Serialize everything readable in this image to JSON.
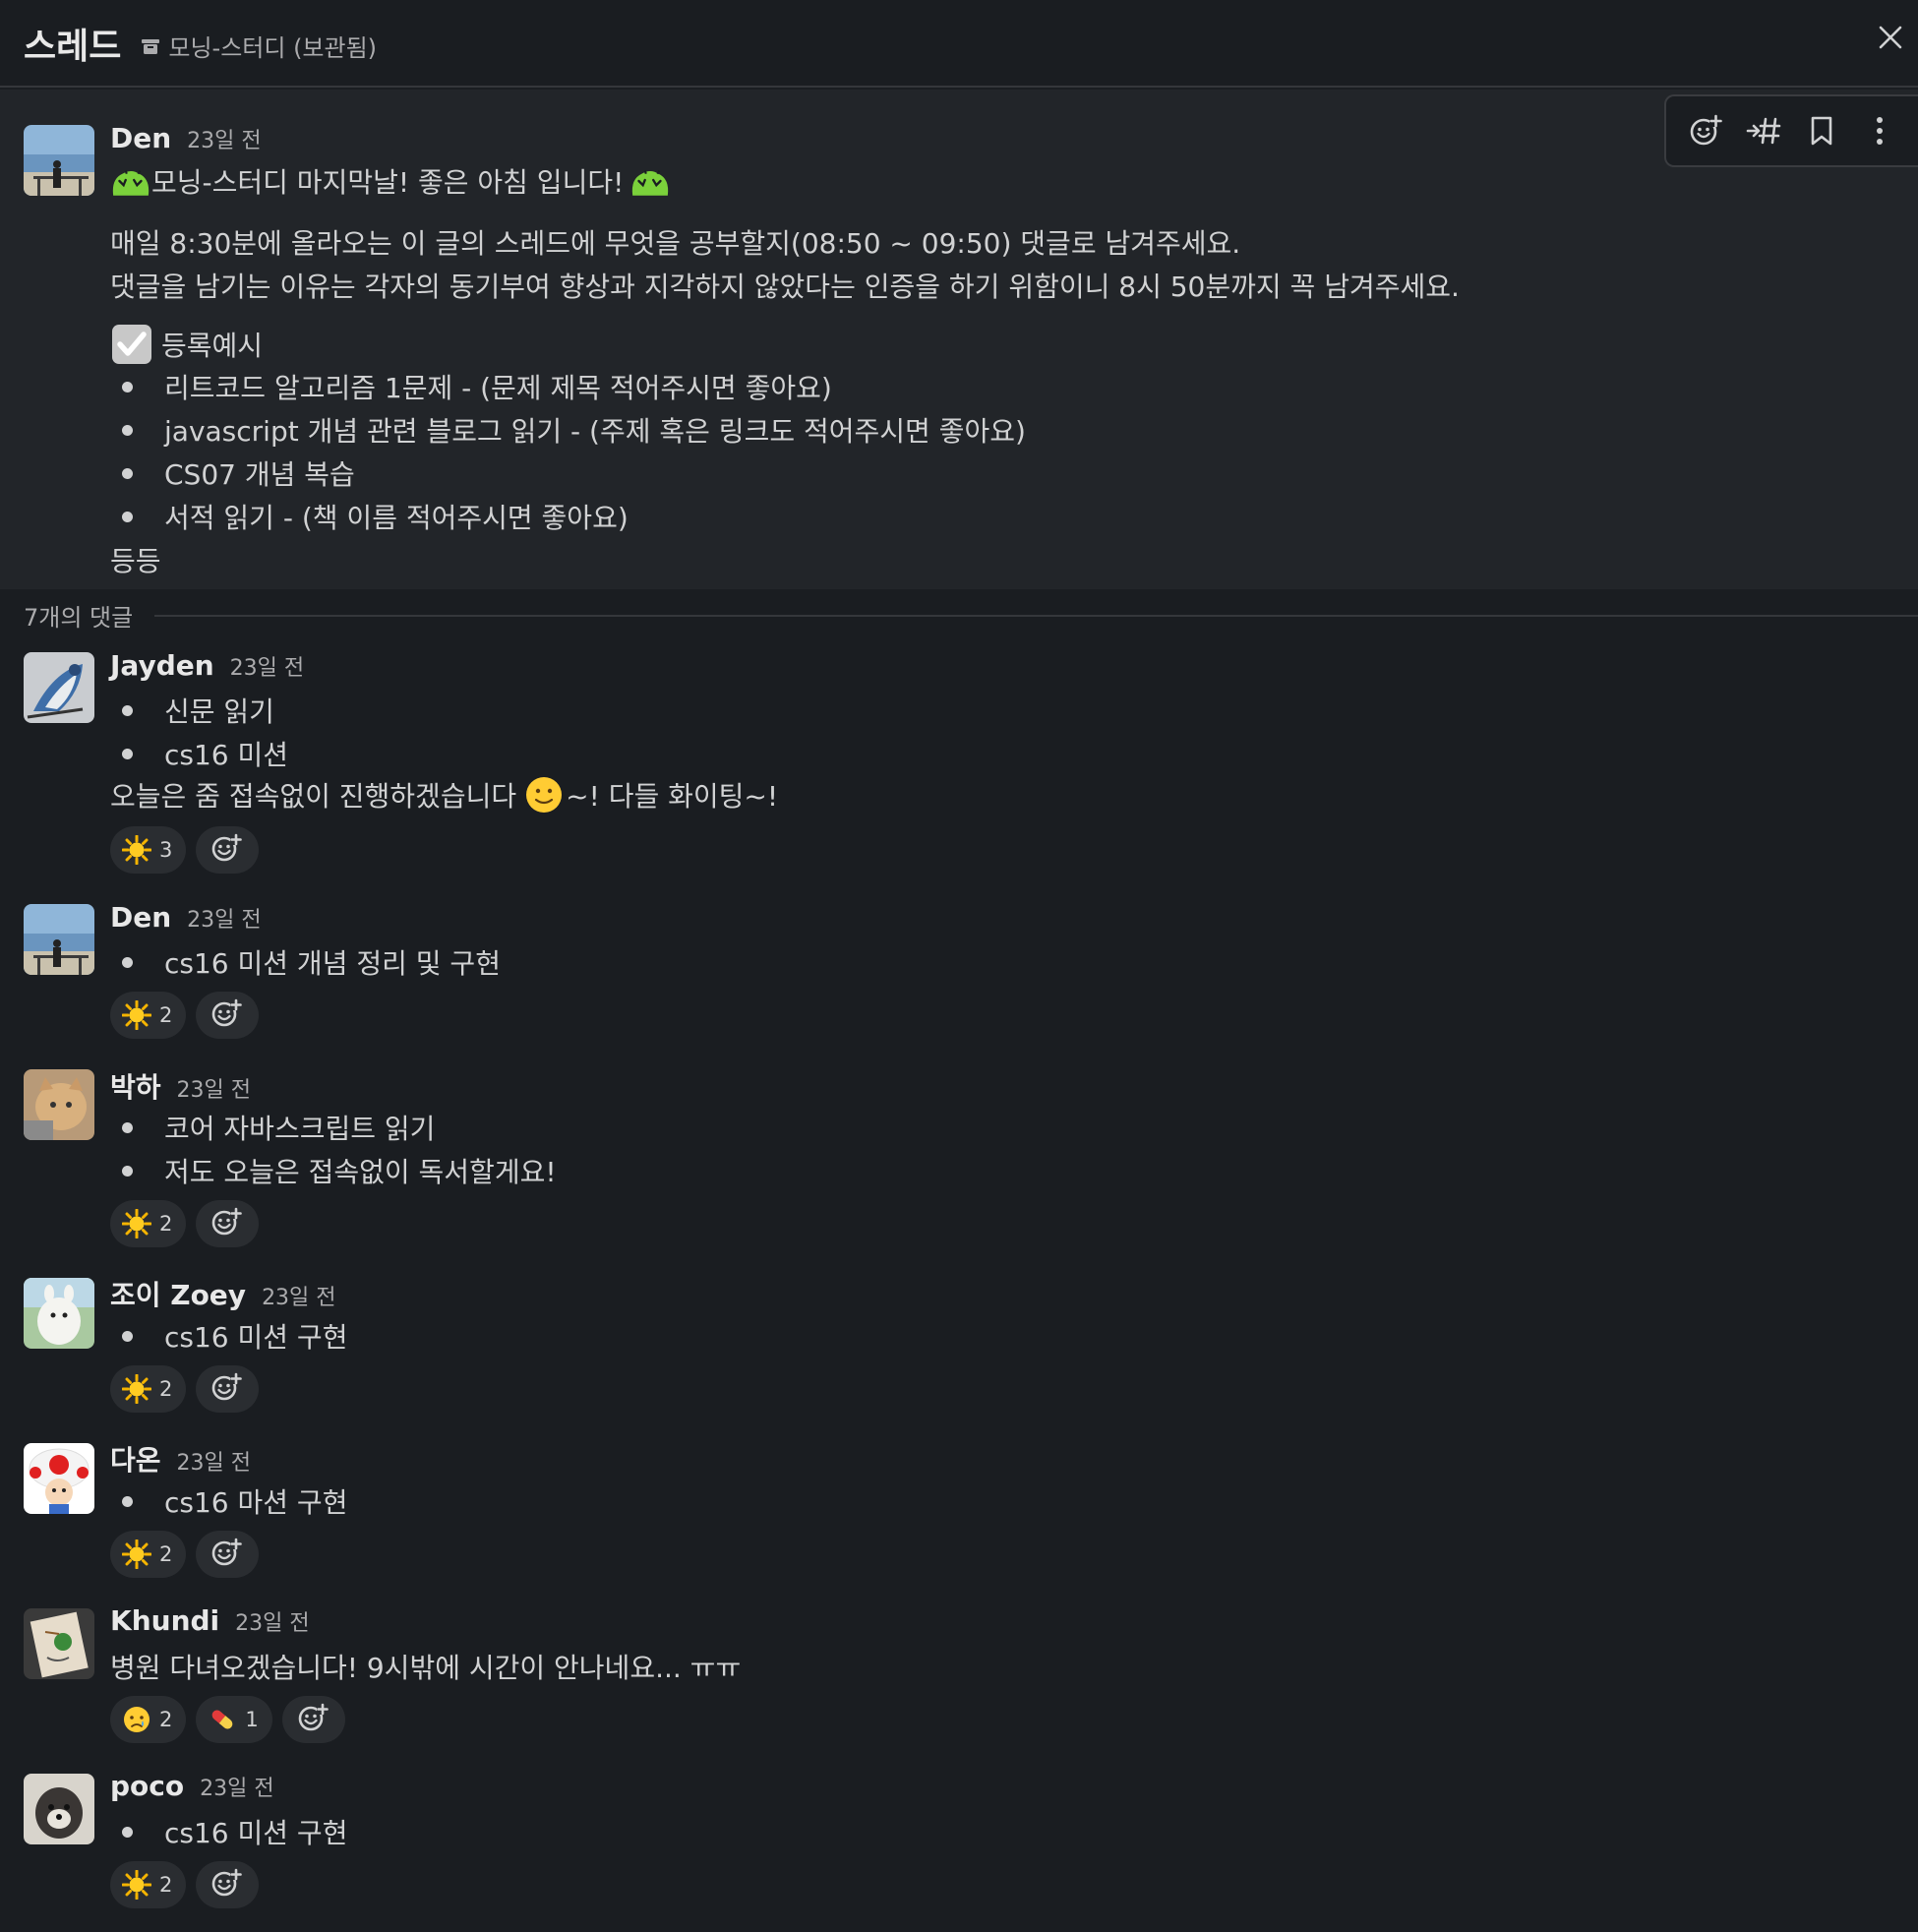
{
  "header": {
    "title": "스레드",
    "channel": "모닝-스터디 (보관됨)"
  },
  "parent_message": {
    "author": "Den",
    "time": "23일 전",
    "title_line": "모닝-스터디 마지막날! 좋은 아침 입니다!",
    "body_lines": [
      "매일 8:30분에 올라오는 이 글의 스레드에 무엇을 공부할지(08:50 ~ 09:50) 댓글로 남겨주세요.",
      "댓글을 남기는 이유는 각자의 동기부여 향상과 지각하지 않았다는 인증을 하기 위함이니 8시 50분까지 꼭 남겨주세요."
    ],
    "example_label": "등록예시",
    "bullets": [
      "리트코드 알고리즘 1문제 - (문제 제목 적어주시면 좋아요)",
      "javascript 개념 관련 블로그 읽기 - (주제 혹은 링크도 적어주시면 좋아요)",
      "CS07 개념 복습",
      "서적 읽기 - (책 이름 적어주시면 좋아요)"
    ],
    "footer": "등등"
  },
  "replies_label": "7개의 댓글",
  "replies": [
    {
      "author": "Jayden",
      "time": "23일 전",
      "bullets": [
        "신문 읽기",
        "cs16 미션"
      ],
      "text_before_emoji": "오늘은 줌 접속없이 진행하겠습니다 ",
      "text_after_emoji": "~! 다들 화이팅~!",
      "reactions": [
        {
          "emoji": "sun-icon",
          "count": "3"
        }
      ]
    },
    {
      "author": "Den",
      "time": "23일 전",
      "bullets": [
        "cs16 미션 개념 정리 및 구현"
      ],
      "reactions": [
        {
          "emoji": "sun-icon",
          "count": "2"
        }
      ]
    },
    {
      "author": "박하",
      "time": "23일 전",
      "bullets": [
        "코어 자바스크립트 읽기",
        "저도 오늘은 접속없이 독서할게요!"
      ],
      "reactions": [
        {
          "emoji": "sun-icon",
          "count": "2"
        }
      ]
    },
    {
      "author": "조이 Zoey",
      "time": "23일 전",
      "bullets": [
        "cs16 미션 구현"
      ],
      "reactions": [
        {
          "emoji": "sun-icon",
          "count": "2"
        }
      ]
    },
    {
      "author": "다온",
      "time": "23일 전",
      "bullets": [
        "cs16 마션 구현"
      ],
      "reactions": [
        {
          "emoji": "sun-icon",
          "count": "2"
        }
      ]
    },
    {
      "author": "Khundi",
      "time": "23일 전",
      "text": "병원 다녀오겠습니다! 9시밖에 시간이 안나네요... ㅠㅠ",
      "reactions": [
        {
          "emoji": "crying-face-icon",
          "count": "2"
        },
        {
          "emoji": "pill-icon",
          "count": "1"
        }
      ]
    },
    {
      "author": "poco",
      "time": "23일 전",
      "bullets": [
        "cs16 미션 구현"
      ],
      "reactions": [
        {
          "emoji": "sun-icon",
          "count": "2"
        }
      ]
    }
  ],
  "colors": {
    "background": "#1a1d21",
    "parent_background": "#222529",
    "text": "#d1d2d3",
    "muted": "#ababad",
    "reaction_bg": "#2a2d31"
  }
}
